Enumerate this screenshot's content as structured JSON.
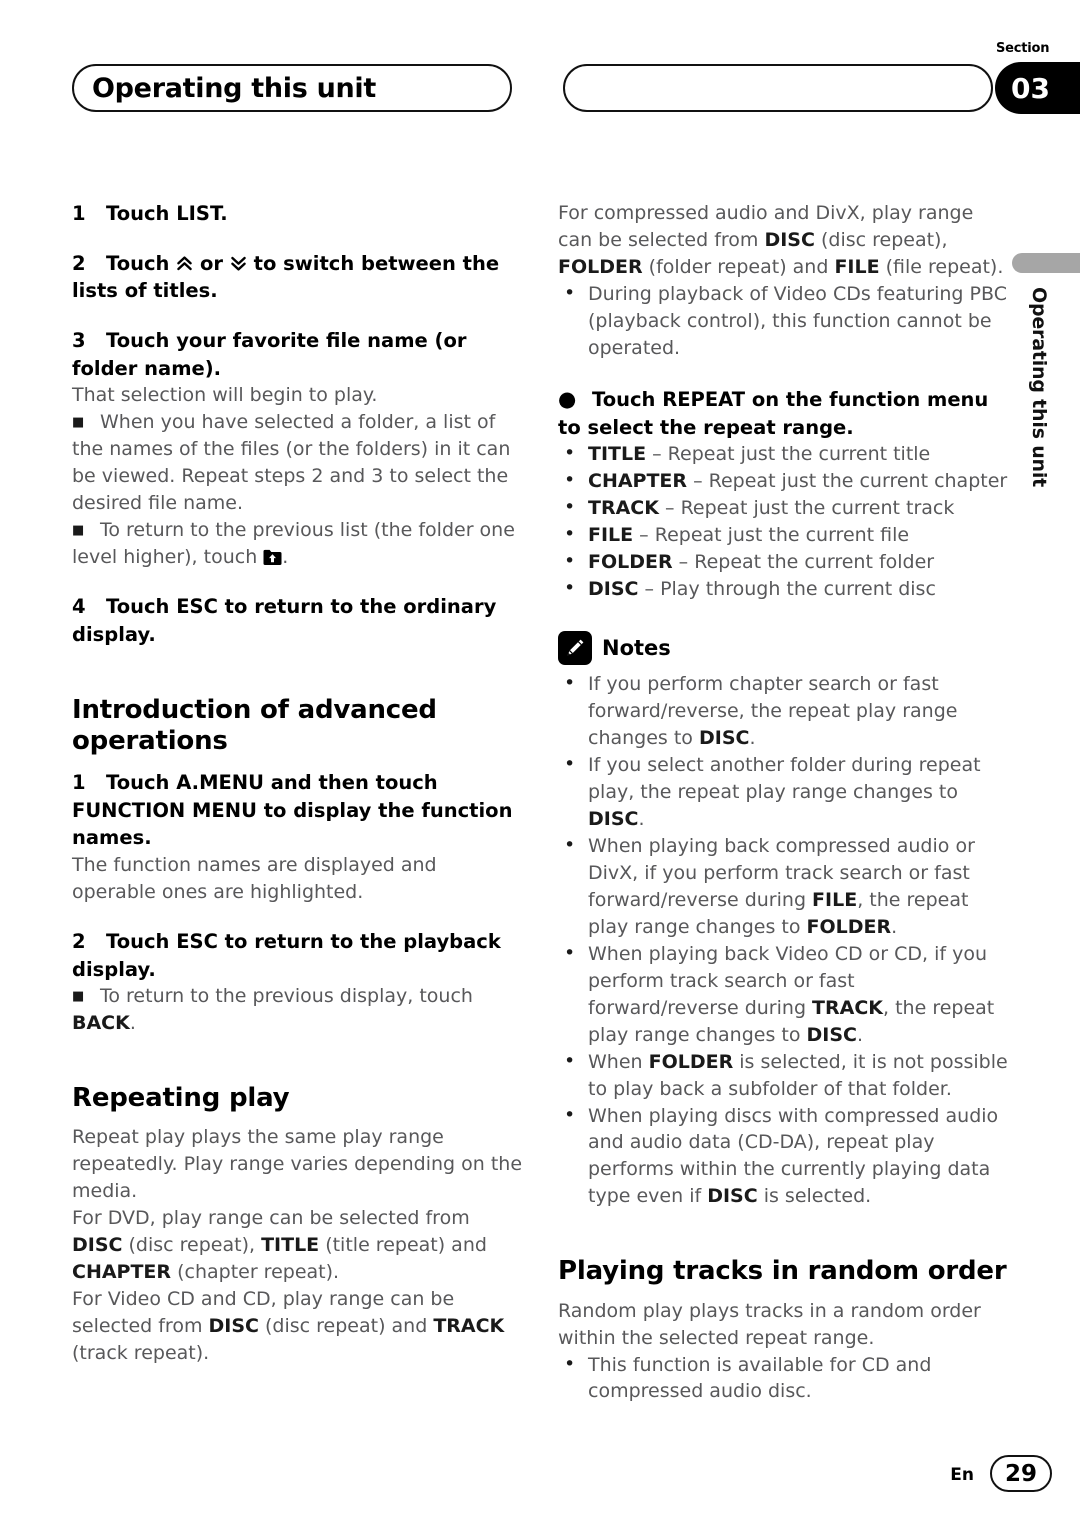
{
  "header": {
    "title": "Operating this unit",
    "section_label": "Section",
    "section_number": "03"
  },
  "side_tab": {
    "text": "Operating this unit"
  },
  "left_column": {
    "step1": {
      "num": "1",
      "text": "Touch LIST."
    },
    "step2": {
      "num": "2",
      "text_before": "Touch",
      "text_mid": "or",
      "text_after": "to switch between the lists of titles."
    },
    "step3": {
      "num": "3",
      "text": "Touch your favorite file name (or folder name)."
    },
    "step3_body": "That selection will begin to play.",
    "step3_note1": "When you have selected a folder, a list of the names of the files (or the folders) in it can be viewed. Repeat steps 2 and 3 to select the desired file name.",
    "step3_note2_before": "To return to the previous list (the folder one level higher), touch",
    "step3_note2_after": ".",
    "step4": {
      "num": "4",
      "text": "Touch ESC to return to the ordinary display."
    },
    "heading_intro": "Introduction of advanced operations",
    "intro_step1": {
      "num": "1",
      "text": "Touch A.MENU and then touch FUNCTION MENU to display the function names."
    },
    "intro_step1_body": "The function names are displayed and operable ones are highlighted.",
    "intro_step2": {
      "num": "2",
      "text": "Touch ESC to return to the playback display."
    },
    "intro_step2_note_before": "To return to the previous display, touch",
    "intro_step2_note_bold": "BACK",
    "intro_step2_note_after": ".",
    "heading_repeating": "Repeating play",
    "repeat_p1": "Repeat play plays the same play range repeatedly. Play range varies depending on the media.",
    "repeat_p2_a": "For DVD, play range can be selected from ",
    "repeat_p2_b1": "DISC",
    "repeat_p2_c": " (disc repeat), ",
    "repeat_p2_b2": "TITLE",
    "repeat_p2_d": " (title repeat) and ",
    "repeat_p2_b3": "CHAPTER",
    "repeat_p2_e": " (chapter repeat).",
    "repeat_p3_a": "For Video CD and CD, play range can be selected from ",
    "repeat_p3_b1": "DISC",
    "repeat_p3_c": " (disc repeat) and ",
    "repeat_p3_b2": "TRACK",
    "repeat_p3_d": " (track repeat)."
  },
  "right_column": {
    "para1_a": "For compressed audio and DivX, play range can be selected from ",
    "para1_b1": "DISC",
    "para1_c": " (disc repeat), ",
    "para1_b2": "FOLDER",
    "para1_d": " (folder repeat) and ",
    "para1_b3": "FILE",
    "para1_e": " (file repeat).",
    "note_pbc": "During playback of Video CDs featuring PBC (playback control), this function cannot be operated.",
    "repeat_instruction": "Touch REPEAT on the function menu to select the repeat range.",
    "repeat_ranges": [
      {
        "term": "TITLE",
        "desc": "Repeat just the current title"
      },
      {
        "term": "CHAPTER",
        "desc": "Repeat just the current chapter"
      },
      {
        "term": "TRACK",
        "desc": "Repeat just the current track"
      },
      {
        "term": "FILE",
        "desc": "Repeat just the current file"
      },
      {
        "term": "FOLDER",
        "desc": "Repeat the current folder"
      },
      {
        "term": "DISC",
        "desc": "Play through the current disc"
      }
    ],
    "notes_title": "Notes",
    "note1_a": "If you perform chapter search or fast forward/reverse, the repeat play range changes to ",
    "note1_b": "DISC",
    "note1_c": ".",
    "note2_a": "If you select another folder during repeat play, the repeat play range changes to ",
    "note2_b": "DISC",
    "note2_c": ".",
    "note3_a": "When playing back compressed audio or DivX, if you perform track search or fast forward/reverse during ",
    "note3_b1": "FILE",
    "note3_c": ", the repeat play range changes to ",
    "note3_b2": "FOLDER",
    "note3_d": ".",
    "note4_a": "When playing back Video CD or CD, if you perform track search or fast forward/reverse during ",
    "note4_b1": "TRACK",
    "note4_c": ", the repeat play range changes to ",
    "note4_b2": "DISC",
    "note4_d": ".",
    "note5_a": "When ",
    "note5_b": "FOLDER",
    "note5_c": " is selected, it is not possible to play back a subfolder of that folder.",
    "note6_a": "When playing discs with compressed audio and audio data (CD-DA), repeat play performs within the currently playing data type even if ",
    "note6_b": "DISC",
    "note6_c": " is selected.",
    "heading_random": "Playing tracks in random order",
    "random_p1": "Random play plays tracks in a random order within the selected repeat range.",
    "random_note1": "This function is available for CD and compressed audio disc."
  },
  "footer": {
    "language": "En",
    "page_number": "29"
  }
}
